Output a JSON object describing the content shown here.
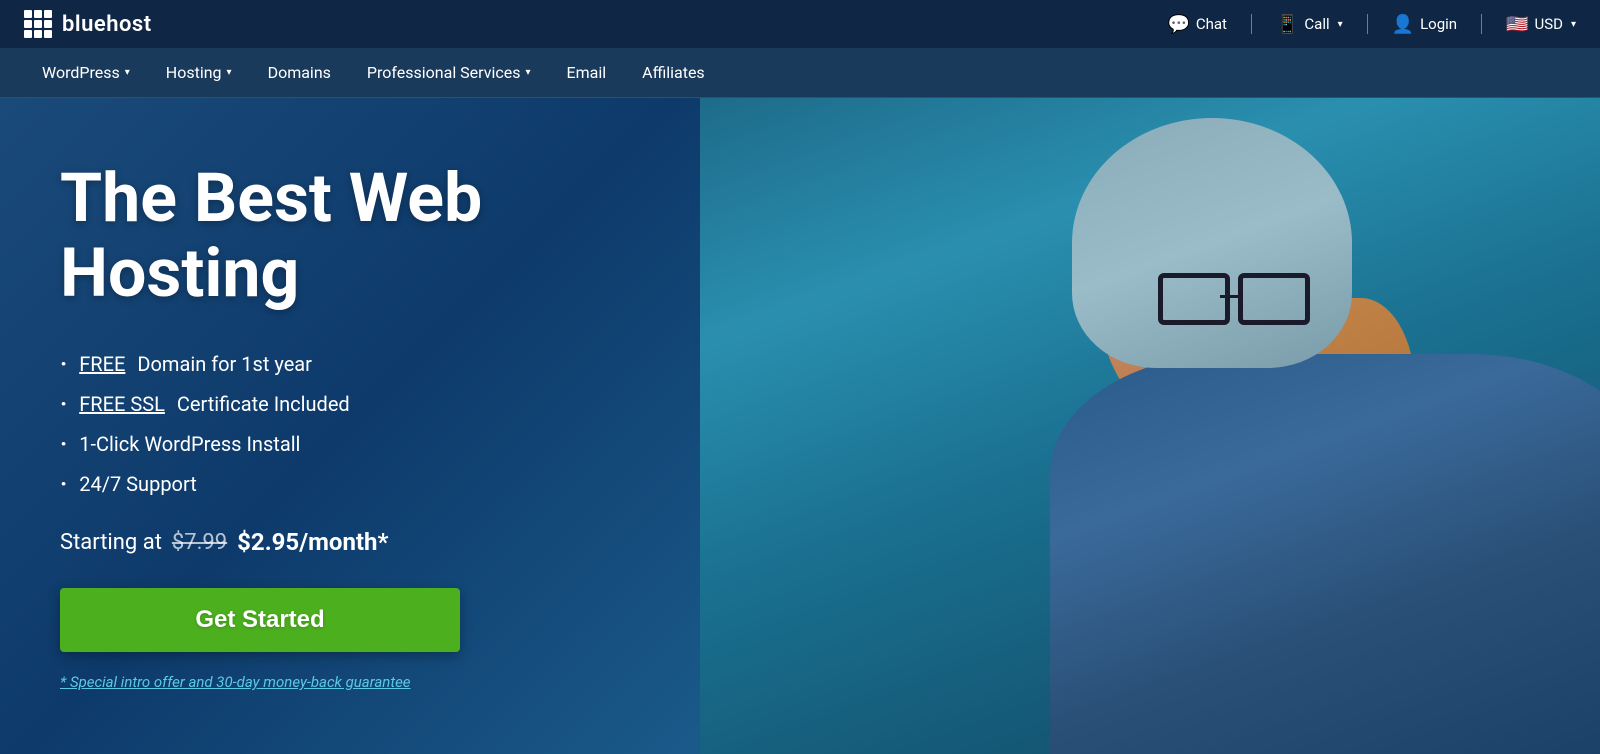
{
  "topbar": {
    "logo_icon": "grid-icon",
    "logo_text": "bluehost",
    "actions": [
      {
        "id": "chat",
        "icon": "💬",
        "label": "Chat",
        "has_caret": false
      },
      {
        "id": "call",
        "icon": "📱",
        "label": "Call",
        "has_caret": true
      },
      {
        "id": "login",
        "icon": "👤",
        "label": "Login",
        "has_caret": false
      },
      {
        "id": "usd",
        "icon": "🇺🇸",
        "label": "USD",
        "has_caret": true
      }
    ]
  },
  "nav": {
    "items": [
      {
        "id": "wordpress",
        "label": "WordPress",
        "has_caret": true
      },
      {
        "id": "hosting",
        "label": "Hosting",
        "has_caret": true
      },
      {
        "id": "domains",
        "label": "Domains",
        "has_caret": false
      },
      {
        "id": "professional-services",
        "label": "Professional Services",
        "has_caret": true
      },
      {
        "id": "email",
        "label": "Email",
        "has_caret": false
      },
      {
        "id": "affiliates",
        "label": "Affiliates",
        "has_caret": false
      }
    ]
  },
  "hero": {
    "title": "The Best Web Hosting",
    "features": [
      {
        "id": "domain",
        "text_underline": "FREE",
        "text_rest": " Domain for 1st year"
      },
      {
        "id": "ssl",
        "text_underline": "FREE SSL",
        "text_rest": " Certificate Included"
      },
      {
        "id": "wordpress",
        "text": "1-Click WordPress Install"
      },
      {
        "id": "support",
        "text": "24/7 Support"
      }
    ],
    "pricing_prefix": "Starting at",
    "old_price": "$7.99",
    "new_price": "$2.95/month*",
    "cta_label": "Get Started",
    "disclaimer": "* Special intro offer and 30-day money-back guarantee"
  }
}
